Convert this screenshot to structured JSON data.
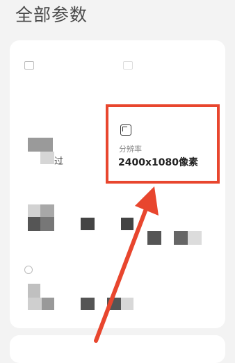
{
  "page": {
    "title": "全部参数"
  },
  "highlighted_spec": {
    "icon": "resolution-icon",
    "label": "分辨率",
    "value": "2400x1080像素"
  },
  "partial_text": {
    "fragment": "过"
  },
  "annotation": {
    "arrow_color": "#e8462e",
    "box_color": "#e8462e"
  }
}
